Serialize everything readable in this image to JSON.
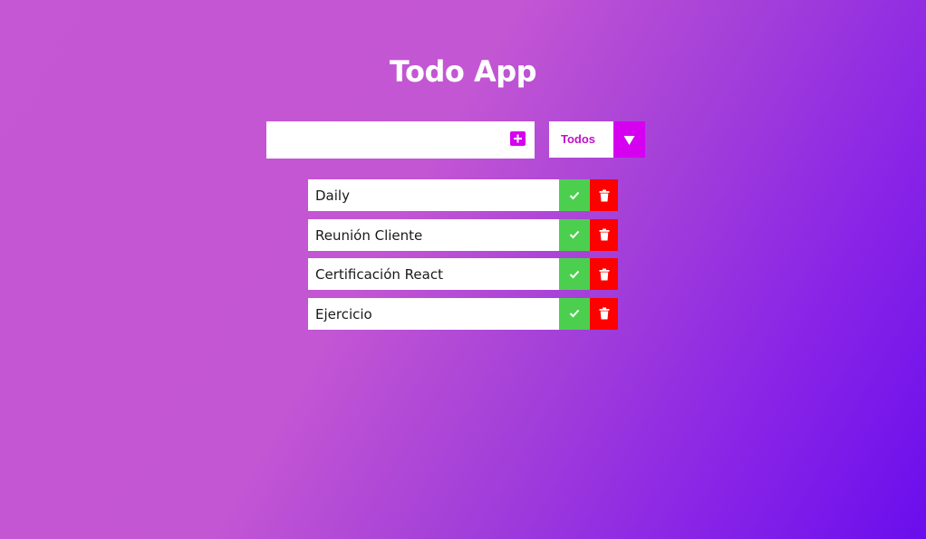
{
  "app": {
    "title": "Todo App"
  },
  "form": {
    "input_value": "",
    "input_placeholder": "",
    "add_icon": "plus-square-icon",
    "filter_selected": "Todos",
    "filter_arrow_icon": "caret-down-icon"
  },
  "todos": [
    {
      "text": "Daily"
    },
    {
      "text": "Reunión Cliente"
    },
    {
      "text": "Certificación React"
    },
    {
      "text": "Ejercicio"
    }
  ],
  "icons": {
    "complete": "check-icon",
    "delete": "trash-icon"
  },
  "colors": {
    "accent": "#d600f0",
    "complete": "#4ccf4f",
    "delete": "#ff0000",
    "background_start": "#c556d4",
    "background_end": "#6a0ded"
  }
}
